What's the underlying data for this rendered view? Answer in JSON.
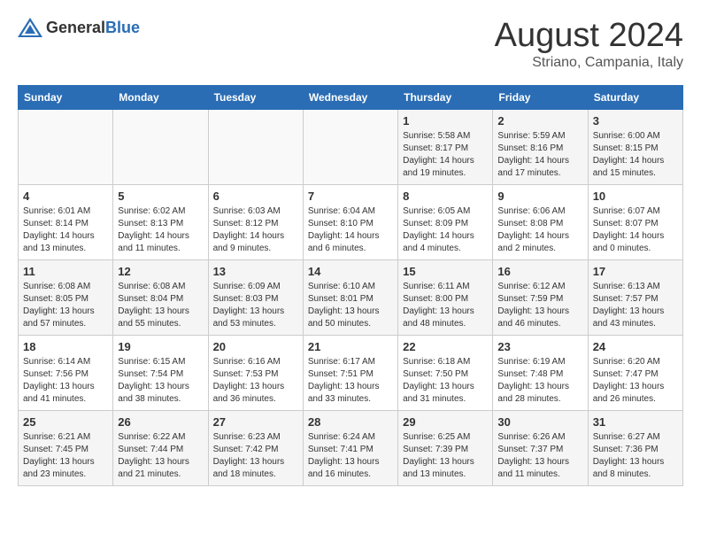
{
  "header": {
    "logo_general": "General",
    "logo_blue": "Blue",
    "month_title": "August 2024",
    "location": "Striano, Campania, Italy"
  },
  "calendar": {
    "days_of_week": [
      "Sunday",
      "Monday",
      "Tuesday",
      "Wednesday",
      "Thursday",
      "Friday",
      "Saturday"
    ],
    "weeks": [
      [
        {
          "day": "",
          "info": ""
        },
        {
          "day": "",
          "info": ""
        },
        {
          "day": "",
          "info": ""
        },
        {
          "day": "",
          "info": ""
        },
        {
          "day": "1",
          "info": "Sunrise: 5:58 AM\nSunset: 8:17 PM\nDaylight: 14 hours\nand 19 minutes."
        },
        {
          "day": "2",
          "info": "Sunrise: 5:59 AM\nSunset: 8:16 PM\nDaylight: 14 hours\nand 17 minutes."
        },
        {
          "day": "3",
          "info": "Sunrise: 6:00 AM\nSunset: 8:15 PM\nDaylight: 14 hours\nand 15 minutes."
        }
      ],
      [
        {
          "day": "4",
          "info": "Sunrise: 6:01 AM\nSunset: 8:14 PM\nDaylight: 14 hours\nand 13 minutes."
        },
        {
          "day": "5",
          "info": "Sunrise: 6:02 AM\nSunset: 8:13 PM\nDaylight: 14 hours\nand 11 minutes."
        },
        {
          "day": "6",
          "info": "Sunrise: 6:03 AM\nSunset: 8:12 PM\nDaylight: 14 hours\nand 9 minutes."
        },
        {
          "day": "7",
          "info": "Sunrise: 6:04 AM\nSunset: 8:10 PM\nDaylight: 14 hours\nand 6 minutes."
        },
        {
          "day": "8",
          "info": "Sunrise: 6:05 AM\nSunset: 8:09 PM\nDaylight: 14 hours\nand 4 minutes."
        },
        {
          "day": "9",
          "info": "Sunrise: 6:06 AM\nSunset: 8:08 PM\nDaylight: 14 hours\nand 2 minutes."
        },
        {
          "day": "10",
          "info": "Sunrise: 6:07 AM\nSunset: 8:07 PM\nDaylight: 14 hours\nand 0 minutes."
        }
      ],
      [
        {
          "day": "11",
          "info": "Sunrise: 6:08 AM\nSunset: 8:05 PM\nDaylight: 13 hours\nand 57 minutes."
        },
        {
          "day": "12",
          "info": "Sunrise: 6:08 AM\nSunset: 8:04 PM\nDaylight: 13 hours\nand 55 minutes."
        },
        {
          "day": "13",
          "info": "Sunrise: 6:09 AM\nSunset: 8:03 PM\nDaylight: 13 hours\nand 53 minutes."
        },
        {
          "day": "14",
          "info": "Sunrise: 6:10 AM\nSunset: 8:01 PM\nDaylight: 13 hours\nand 50 minutes."
        },
        {
          "day": "15",
          "info": "Sunrise: 6:11 AM\nSunset: 8:00 PM\nDaylight: 13 hours\nand 48 minutes."
        },
        {
          "day": "16",
          "info": "Sunrise: 6:12 AM\nSunset: 7:59 PM\nDaylight: 13 hours\nand 46 minutes."
        },
        {
          "day": "17",
          "info": "Sunrise: 6:13 AM\nSunset: 7:57 PM\nDaylight: 13 hours\nand 43 minutes."
        }
      ],
      [
        {
          "day": "18",
          "info": "Sunrise: 6:14 AM\nSunset: 7:56 PM\nDaylight: 13 hours\nand 41 minutes."
        },
        {
          "day": "19",
          "info": "Sunrise: 6:15 AM\nSunset: 7:54 PM\nDaylight: 13 hours\nand 38 minutes."
        },
        {
          "day": "20",
          "info": "Sunrise: 6:16 AM\nSunset: 7:53 PM\nDaylight: 13 hours\nand 36 minutes."
        },
        {
          "day": "21",
          "info": "Sunrise: 6:17 AM\nSunset: 7:51 PM\nDaylight: 13 hours\nand 33 minutes."
        },
        {
          "day": "22",
          "info": "Sunrise: 6:18 AM\nSunset: 7:50 PM\nDaylight: 13 hours\nand 31 minutes."
        },
        {
          "day": "23",
          "info": "Sunrise: 6:19 AM\nSunset: 7:48 PM\nDaylight: 13 hours\nand 28 minutes."
        },
        {
          "day": "24",
          "info": "Sunrise: 6:20 AM\nSunset: 7:47 PM\nDaylight: 13 hours\nand 26 minutes."
        }
      ],
      [
        {
          "day": "25",
          "info": "Sunrise: 6:21 AM\nSunset: 7:45 PM\nDaylight: 13 hours\nand 23 minutes."
        },
        {
          "day": "26",
          "info": "Sunrise: 6:22 AM\nSunset: 7:44 PM\nDaylight: 13 hours\nand 21 minutes."
        },
        {
          "day": "27",
          "info": "Sunrise: 6:23 AM\nSunset: 7:42 PM\nDaylight: 13 hours\nand 18 minutes."
        },
        {
          "day": "28",
          "info": "Sunrise: 6:24 AM\nSunset: 7:41 PM\nDaylight: 13 hours\nand 16 minutes."
        },
        {
          "day": "29",
          "info": "Sunrise: 6:25 AM\nSunset: 7:39 PM\nDaylight: 13 hours\nand 13 minutes."
        },
        {
          "day": "30",
          "info": "Sunrise: 6:26 AM\nSunset: 7:37 PM\nDaylight: 13 hours\nand 11 minutes."
        },
        {
          "day": "31",
          "info": "Sunrise: 6:27 AM\nSunset: 7:36 PM\nDaylight: 13 hours\nand 8 minutes."
        }
      ]
    ]
  }
}
